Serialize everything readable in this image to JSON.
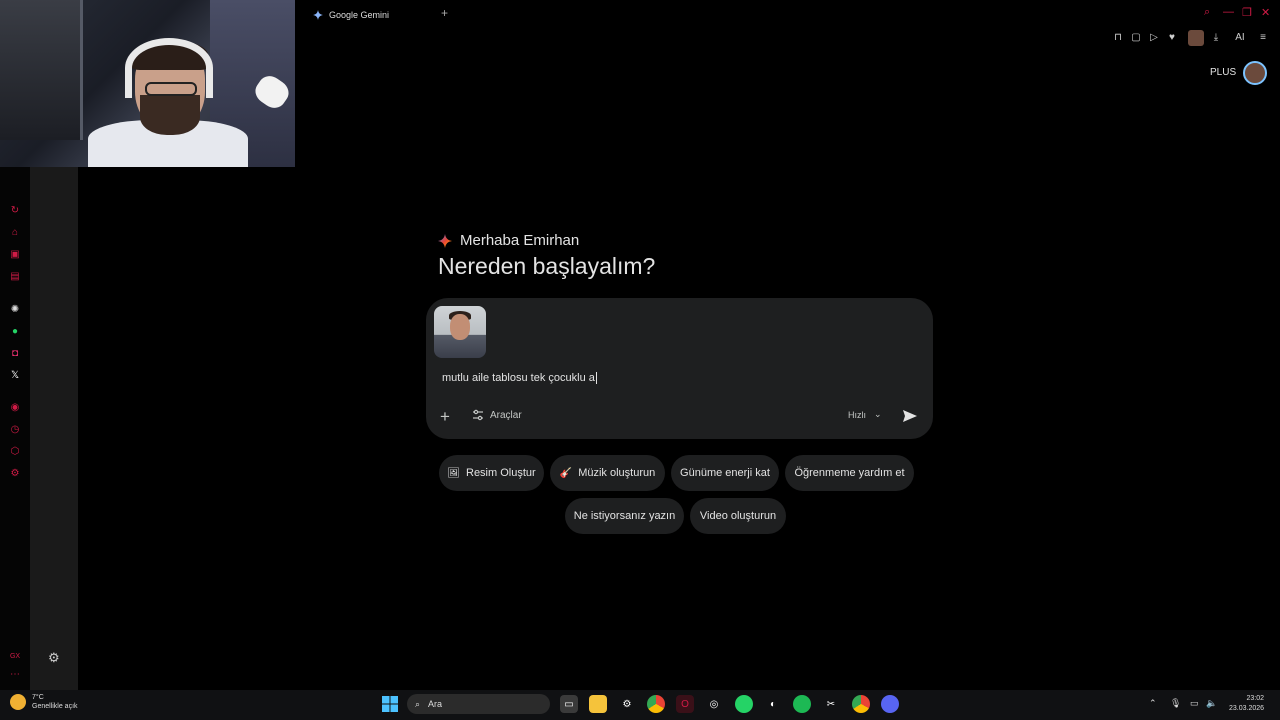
{
  "browser": {
    "tab_title": "Google Gemini",
    "new_tab_symbol": "+",
    "ai_label": "AI"
  },
  "account": {
    "plan_badge": "PLUS"
  },
  "gemini": {
    "greeting": "Merhaba Emirhan",
    "heading": "Nereden başlayalım?",
    "prompt_text": "mutlu aile tablosu tek çocuklu a",
    "tools_label": "Araçlar",
    "model_label": "Hızlı",
    "suggestions_row1": [
      {
        "icon": "🖼",
        "label": "Resim Oluştur"
      },
      {
        "icon": "🎸",
        "label": "Müzik oluşturun"
      },
      {
        "icon": "",
        "label": "Günüme enerji kat"
      },
      {
        "icon": "",
        "label": "Öğrenmeme yardım et"
      }
    ],
    "suggestions_row2": [
      {
        "label": "Ne istiyorsanız yazın"
      },
      {
        "label": "Video oluşturun"
      }
    ]
  },
  "sidebar": {
    "bottom_label": "GX"
  },
  "taskbar": {
    "weather_temp": "7°C",
    "weather_desc": "Genellikle açık",
    "search_placeholder": "Ara",
    "time": "23:02",
    "date": "23.03.2026"
  },
  "colors": {
    "accent_opera": "#d11b46",
    "background": "#000000",
    "chat_surface": "#1e1f20"
  }
}
